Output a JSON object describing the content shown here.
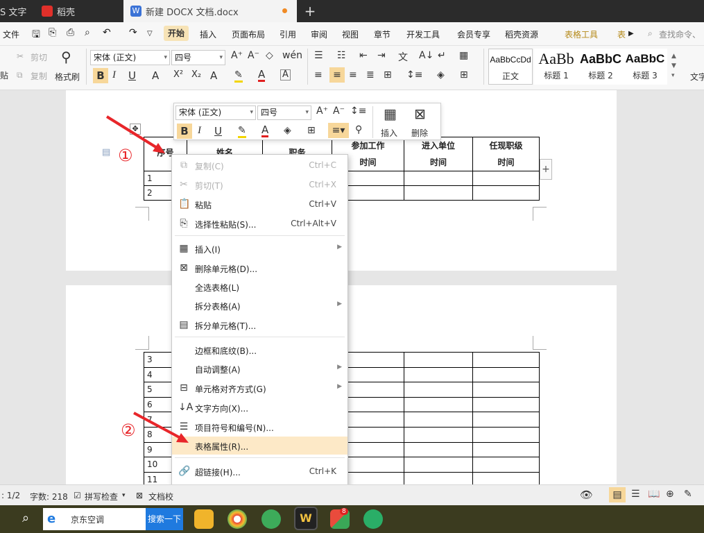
{
  "tabs": [
    {
      "label": "S 文字",
      "color": "#d23f31"
    },
    {
      "label": "稻壳",
      "color": "#e0302a"
    },
    {
      "label": "新建 DOCX 文档.docx",
      "color": "#3a72d6"
    }
  ],
  "new_tab": "+",
  "menu": {
    "file": "文件",
    "items": [
      "开始",
      "插入",
      "页面布局",
      "引用",
      "审阅",
      "视图",
      "章节",
      "开发工具",
      "会员专享",
      "稻壳资源"
    ],
    "table_tools": "表格工具",
    "table_style": "表",
    "search": "查找命令、"
  },
  "toolbar": {
    "cut": "剪切",
    "copy": "复制",
    "paste_frag": "贴",
    "format_painter": "格式刷",
    "font_name": "宋体 (正文)",
    "font_size": "四号",
    "styles": [
      {
        "preview": "AaBbCcDd",
        "name": "正文"
      },
      {
        "preview": "AaBb",
        "name": "标题 1"
      },
      {
        "preview": "AaBbC",
        "name": "标题 2"
      },
      {
        "preview": "AaBbC",
        "name": "标题 3"
      }
    ],
    "text_tool": "文字"
  },
  "mini_toolbar": {
    "font_name": "宋体 (正文)",
    "font_size": "四号",
    "insert": "插入",
    "delete": "删除"
  },
  "table": {
    "headers": [
      "序号",
      "姓名",
      "职务",
      "参加工作时间",
      "进入单位时间",
      "任现职级时间"
    ],
    "header_visible": {
      "h0": "序号",
      "h1": "姓名",
      "h2": "职务",
      "h3a": "参加工作",
      "h3b": "时间",
      "h4a": "进入单位",
      "h4b": "时间",
      "h5a": "任现职级",
      "h5b": "时间"
    },
    "page1_rows": [
      "1",
      "2"
    ],
    "page2_rows": [
      "3",
      "4",
      "5",
      "6",
      "7",
      "8",
      "9",
      "10",
      "11"
    ]
  },
  "context_menu": {
    "items": [
      {
        "label": "复制(C)",
        "shortcut": "Ctrl+C",
        "icon": "copy-icon",
        "disabled": true
      },
      {
        "label": "剪切(T)",
        "shortcut": "Ctrl+X",
        "icon": "scissors-icon",
        "disabled": true
      },
      {
        "label": "粘贴",
        "shortcut": "Ctrl+V",
        "icon": "paste-icon"
      },
      {
        "label": "选择性粘贴(S)...",
        "shortcut": "Ctrl+Alt+V",
        "icon": "paste-special-icon"
      },
      {
        "label": "插入(I)",
        "icon": "table-insert-icon",
        "submenu": true
      },
      {
        "label": "删除单元格(D)...",
        "icon": "delete-cell-icon"
      },
      {
        "label": "全选表格(L)"
      },
      {
        "label": "拆分表格(A)",
        "submenu": true
      },
      {
        "label": "拆分单元格(T)...",
        "icon": "split-cell-icon"
      },
      {
        "label": "边框和底纹(B)..."
      },
      {
        "label": "自动调整(A)",
        "submenu": true
      },
      {
        "label": "单元格对齐方式(G)",
        "icon": "cell-align-icon",
        "submenu": true
      },
      {
        "label": "文字方向(X)...",
        "icon": "text-direction-icon"
      },
      {
        "label": "项目符号和编号(N)...",
        "icon": "bullet-list-icon"
      },
      {
        "label": "表格属性(R)...",
        "highlighted": true
      },
      {
        "label": "超链接(H)...",
        "shortcut": "Ctrl+K",
        "icon": "link-icon"
      }
    ]
  },
  "annotations": {
    "one": "①",
    "two": "②"
  },
  "status": {
    "page": ": 1/2",
    "words": "字数: 218",
    "spell": "拼写检查",
    "doc_check": "文档校"
  },
  "taskbar": {
    "search_text": "京东空调",
    "search_button": "搜索一下",
    "wps_badge": "8"
  },
  "colors": {
    "accent_tab": "#f7e3b6",
    "menu_highlight": "#fde9c7",
    "annotation_red": "#e8262a"
  }
}
